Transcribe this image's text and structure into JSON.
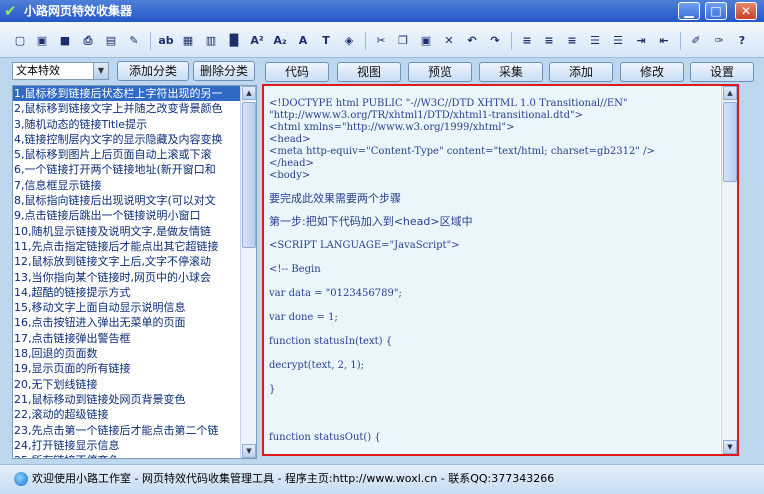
{
  "window": {
    "title": "小路网页特效收集器",
    "controls": {
      "minimize": "▁",
      "maximize": "□",
      "close": "✕"
    }
  },
  "toolbar": {
    "icons": [
      "new-file-icon",
      "open-folder-icon",
      "save-icon",
      "print-icon",
      "print-preview-icon",
      "find-icon",
      "spellcheck-icon",
      "table-icon",
      "bold-insert-icon",
      "paragraph-icon",
      "superscript-icon",
      "subscript-icon",
      "font-icon",
      "font-color-icon",
      "highlight-icon",
      "cut-icon",
      "copy-icon",
      "paste-icon",
      "delete-icon",
      "undo-icon",
      "redo-icon",
      "align-left-icon",
      "align-center-icon",
      "align-right-icon",
      "bullet-list-icon",
      "numbered-list-icon",
      "indent-icon",
      "outdent-icon",
      "edit-icon",
      "pen-icon",
      "help-icon"
    ],
    "glyphs": [
      "▢",
      "▣",
      "■",
      "⎙",
      "▤",
      "✎",
      "ab",
      "▦",
      "▥",
      "█",
      "A²",
      "A₂",
      "A",
      "T",
      "◈",
      "✂",
      "❐",
      "▣",
      "✕",
      "↶",
      "↷",
      "≡",
      "≡",
      "≡",
      "☰",
      "☰",
      "⇥",
      "⇤",
      "✐",
      "✑",
      "?"
    ]
  },
  "left_panel": {
    "category": "文本特效",
    "add_category_label": "添加分类",
    "delete_category_label": "删除分类",
    "selected_index": 0,
    "items": [
      "1,鼠标移到链接后状态栏上字符出现的另一",
      "2,鼠标移到链接文字上并随之改变背景颜色",
      "3,随机动态的链接Title提示",
      "4,链接控制层内文字的显示隐藏及内容变换",
      "5,鼠标移到图片上后页面自动上滚或下滚",
      "6,一个链接打开两个链接地址(新开窗口和",
      "7,信息框显示链接",
      "8,鼠标指向链接后出现说明文字(可以对文",
      "9,点击链接后跳出一个链接说明小窗口",
      "10,随机显示链接及说明文字,是做友情链",
      "11,先点击指定链接后才能点出其它超链接",
      "12,鼠标放到链接文字上后,文字不停滚动",
      "13,当你指向某个链接时,网页中的小球会",
      "14,超酷的链接提示方式",
      "15,移动文字上面自动显示说明信息",
      "16,点击按钮进入弹出无菜单的页面",
      "17,点击链接弹出警告框",
      "18,回退的页面数",
      "19,显示页面的所有链接",
      "20,无下划线链接",
      "21,鼠标移动到链接处网页背景变色",
      "22,滚动的超级链接",
      "23,先点击第一个链接后才能点击第二个链",
      "24,打开链接显示信息",
      "25,所有链接不停变色"
    ]
  },
  "right_panel": {
    "buttons": [
      "代码",
      "视图",
      "预览",
      "采集",
      "添加",
      "修改",
      "设置"
    ],
    "code_lines": [
      "<!DOCTYPE html PUBLIC \"-//W3C//DTD XHTML 1.0 Transitional//EN\"",
      "\"http://www.w3.org/TR/xhtml1/DTD/xhtml1-transitional.dtd\">",
      "<html xmlns=\"http://www.w3.org/1999/xhtml\">",
      "<head>",
      "<meta http-equiv=\"Content-Type\" content=\"text/html; charset=gb2312\" />",
      "</head>",
      "<body>"
    ],
    "para_step_intro": "要完成此效果需要两个步骤",
    "para_step_one": "第一步:把如下代码加入到<head>区域中",
    "script_lines": [
      "<SCRIPT LANGUAGE=\"JavaScript\">",
      "<!-- Begin",
      "var data = \"0123456789\";",
      "var done = 1;",
      "function statusIn(text) {",
      "decrypt(text, 2, 1);",
      "}",
      "",
      "function statusOut() {"
    ]
  },
  "status": {
    "text": "欢迎使用小路工作室 - 网页特效代码收集管理工具 - 程序主页:http://www.woxl.cn - 联系QQ:377343266"
  }
}
